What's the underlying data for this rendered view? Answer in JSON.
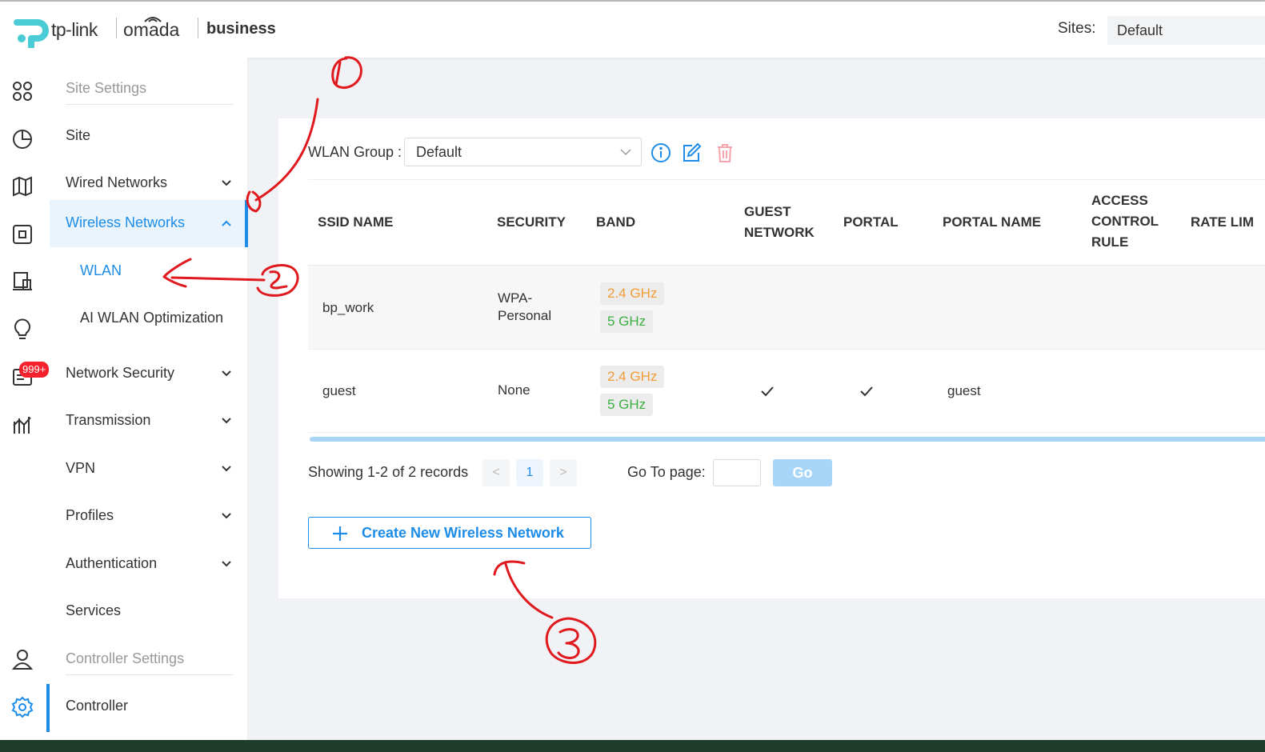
{
  "header": {
    "brand_tplink": "tp-link",
    "brand_omada": "omada",
    "brand_business": "business",
    "sites_label": "Sites:",
    "sites_value": "Default"
  },
  "iconbar": {
    "icons": [
      "dashboard-icon",
      "statistics-icon",
      "map-icon",
      "devices-icon",
      "clients-icon",
      "insight-icon",
      "logs-icon",
      "reports-icon",
      "account-icon",
      "settings-icon"
    ],
    "badge": "999+",
    "active": "settings-icon"
  },
  "sidebar": {
    "site_settings_header": "Site Settings",
    "site": "Site",
    "wired_networks": "Wired Networks",
    "wireless_networks": "Wireless Networks",
    "wlan": "WLAN",
    "ai_wlan_optimization": "AI WLAN Optimization",
    "network_security": "Network Security",
    "transmission": "Transmission",
    "vpn": "VPN",
    "profiles": "Profiles",
    "authentication": "Authentication",
    "services": "Services",
    "controller_settings_header": "Controller Settings",
    "controller": "Controller"
  },
  "wlan_group": {
    "label": "WLAN Group :",
    "value": "Default"
  },
  "table": {
    "columns": [
      "SSID NAME",
      "SECURITY",
      "BAND",
      "GUEST NETWORK",
      "PORTAL",
      "PORTAL NAME",
      "ACCESS CONTROL RULE",
      "RATE LIM"
    ],
    "column_lines": {
      "guest_network": [
        "GUEST",
        "NETWORK"
      ],
      "access_control_rule": [
        "ACCESS",
        "CONTROL",
        "RULE"
      ]
    },
    "rows": [
      {
        "ssid": "bp_work",
        "security_lines": [
          "WPA-",
          "Personal"
        ],
        "bands": [
          "2.4 GHz",
          "5 GHz"
        ],
        "guest_network": false,
        "portal": false,
        "portal_name": ""
      },
      {
        "ssid": "guest",
        "security_lines": [
          "None"
        ],
        "bands": [
          "2.4 GHz",
          "5 GHz"
        ],
        "guest_network": true,
        "portal": true,
        "portal_name": "guest"
      }
    ]
  },
  "pagination": {
    "records_text": "Showing 1-2 of 2 records",
    "prev": "<",
    "current_page": "1",
    "next": ">",
    "goto_label": "Go To page:",
    "goto_value": "",
    "go_label": "Go"
  },
  "create_button": {
    "label": "Create New Wireless Network"
  },
  "colors": {
    "accent": "#1c8ce8",
    "band_24": "#f39c35",
    "band_5": "#3cb043",
    "annotation": "#e0191f",
    "badge": "#f5222d"
  }
}
